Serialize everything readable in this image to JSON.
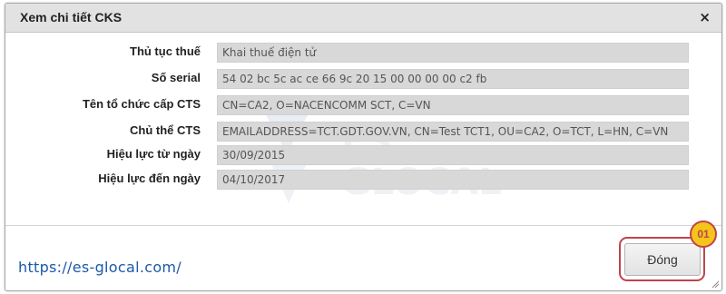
{
  "dialog": {
    "title": "Xem chi tiết CKS",
    "close_symbol": "×"
  },
  "fields": [
    {
      "label": "Thủ tục thuế",
      "value": "Khai thuế điện tử"
    },
    {
      "label": "Số serial",
      "value": "54 02 bc 5c ac ce 66 9c 20 15 00 00 00 00 c2 fb"
    },
    {
      "label": "Tên tổ chức cấp CTS",
      "value": "CN=CA2, O=NACENCOMM SCT, C=VN"
    },
    {
      "label": "Chủ thể CTS",
      "value": "EMAILADDRESS=TCT.GDT.GOV.VN, CN=Test TCT1, OU=CA2, O=TCT, L=HN, C=VN"
    },
    {
      "label": "Hiệu lực từ ngày",
      "value": "30/09/2015"
    },
    {
      "label": "Hiệu lực đến ngày",
      "value": "04/10/2017"
    }
  ],
  "footer": {
    "close_button": "Đóng",
    "website": "https://es-glocal.com/",
    "step_badge": "01"
  },
  "colors": {
    "titlebar": "#e2e2e2",
    "field_background": "#d8d8d8",
    "highlight": "#c0444b",
    "badge": "#f4c51a",
    "link": "#1a5aa8"
  }
}
